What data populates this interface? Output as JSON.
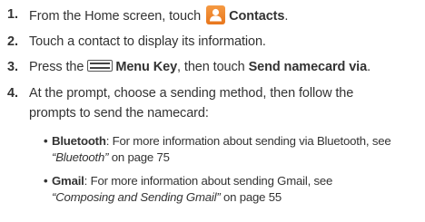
{
  "steps": [
    {
      "number": "1.",
      "prefix": "From the Home screen, touch",
      "icon": "contacts-icon",
      "bold": "Contacts",
      "suffix": "."
    },
    {
      "number": "2.",
      "text": "Touch a contact to display its information."
    },
    {
      "number": "3.",
      "prefix": "Press the",
      "icon": "menu-key-icon",
      "bold": "Menu Key",
      "middle": ", then touch",
      "bold2": "Send namecard via",
      "suffix": "."
    },
    {
      "number": "4.",
      "line1": "At the prompt, choose a sending method, then follow the",
      "line2": "prompts to send the namecard:"
    }
  ],
  "bullets": [
    {
      "symbol": "•",
      "label": "Bluetooth",
      "text": ": For more information about sending via Bluetooth, see",
      "link": "“Bluetooth”",
      "page_ref": " on page 75"
    },
    {
      "symbol": "•",
      "label": "Gmail",
      "text": ": For more information about sending Gmail, see",
      "link": "“Composing and Sending Gmail”",
      "page_ref": " on page 55"
    }
  ],
  "colors": {
    "text": "#333333",
    "contacts_icon": "#f0892f"
  }
}
